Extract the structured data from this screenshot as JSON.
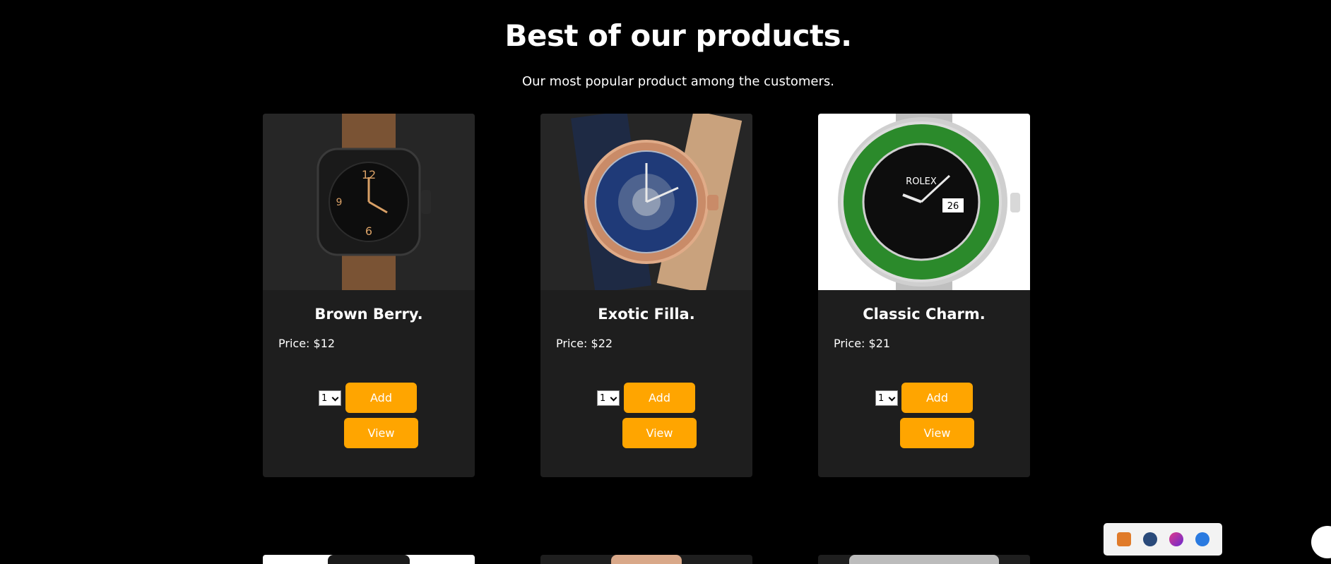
{
  "section": {
    "title": "Best of our products.",
    "subtitle": "Our most popular product among the customers."
  },
  "products": [
    {
      "name": "Brown Berry.",
      "price": "Price: $12",
      "quantity": "1",
      "add_label": "Add",
      "view_label": "View"
    },
    {
      "name": "Exotic Filla.",
      "price": "Price: $22",
      "quantity": "1",
      "add_label": "Add",
      "view_label": "View"
    },
    {
      "name": "Classic Charm.",
      "price": "Price: $21",
      "quantity": "1",
      "add_label": "Add",
      "view_label": "View"
    }
  ],
  "colors": {
    "background": "#000000",
    "card": "#1e1e1e",
    "accent": "#ffa500"
  },
  "tray_icons": [
    "xampp-icon",
    "steam-icon",
    "firefox-icon",
    "bluetooth-icon"
  ]
}
